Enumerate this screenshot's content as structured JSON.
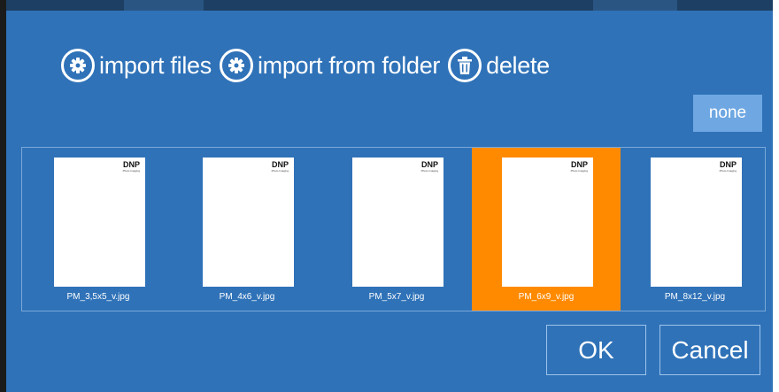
{
  "toolbar": {
    "import_files": {
      "label": "import files",
      "icon": "gear-icon"
    },
    "import_folder": {
      "label": "import from folder",
      "icon": "gear-icon"
    },
    "delete": {
      "label": "delete",
      "icon": "trash-icon"
    }
  },
  "selection": {
    "none_label": "none"
  },
  "files": [
    {
      "name": "PM_3,5x5_v.jpg",
      "logo": "DNP",
      "logo_sub": "Photo Imaging",
      "selected": false
    },
    {
      "name": "PM_4x6_v.jpg",
      "logo": "DNP",
      "logo_sub": "Photo Imaging",
      "selected": false
    },
    {
      "name": "PM_5x7_v.jpg",
      "logo": "DNP",
      "logo_sub": "Photo Imaging",
      "selected": false
    },
    {
      "name": "PM_6x9_v.jpg",
      "logo": "DNP",
      "logo_sub": "Photo Imaging",
      "selected": true
    },
    {
      "name": "PM_8x12_v.jpg",
      "logo": "DNP",
      "logo_sub": "Photo Imaging",
      "selected": false
    }
  ],
  "buttons": {
    "ok": "OK",
    "cancel": "Cancel"
  },
  "colors": {
    "dialog_bg": "#2f72b8",
    "selected_bg": "#ff8a00",
    "none_button_bg": "#6ea7e2"
  }
}
